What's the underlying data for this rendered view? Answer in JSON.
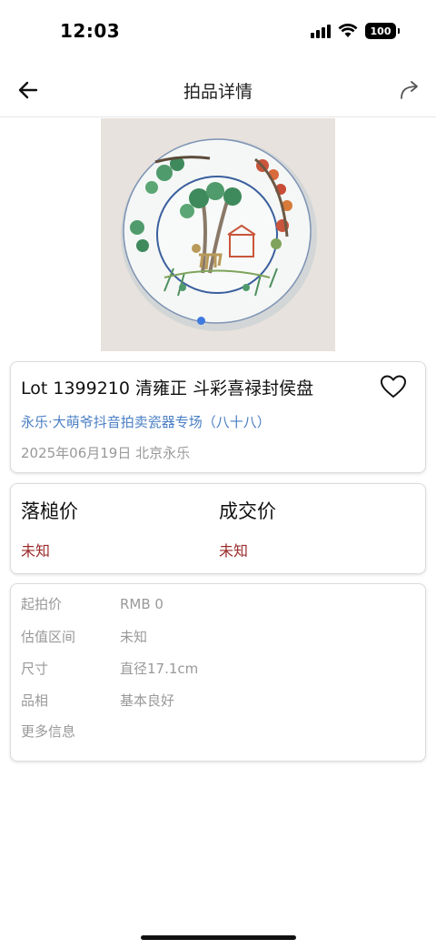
{
  "status": {
    "time": "12:03",
    "battery": "100"
  },
  "nav": {
    "title": "拍品详情",
    "back_icon": "arrow-left-icon",
    "share_icon": "share-arrow-icon"
  },
  "lot": {
    "title": "Lot 1399210 清雍正 斗彩喜禄封侯盘",
    "session": "永乐·大萌爷抖音拍卖瓷器专场（八十八）",
    "date_place": "2025年06月19日 北京永乐",
    "image_description_icon": "porcelain-plate-image",
    "favorite_icon": "heart-outline-icon"
  },
  "prices": {
    "hammer_label": "落槌价",
    "hammer_value": "未知",
    "deal_label": "成交价",
    "deal_value": "未知"
  },
  "info": {
    "rows": [
      {
        "key": "起拍价",
        "value": "RMB 0"
      },
      {
        "key": "估值区间",
        "value": "未知"
      },
      {
        "key": "尺寸",
        "value": "直径17.1cm"
      },
      {
        "key": "品相",
        "value": "基本良好"
      },
      {
        "key": "更多信息",
        "value": ""
      }
    ]
  },
  "colors": {
    "accent_link": "#4a7fc4",
    "price_red": "#9b2b2b",
    "muted": "#999999",
    "carousel_dot": "#3f7ae0"
  }
}
